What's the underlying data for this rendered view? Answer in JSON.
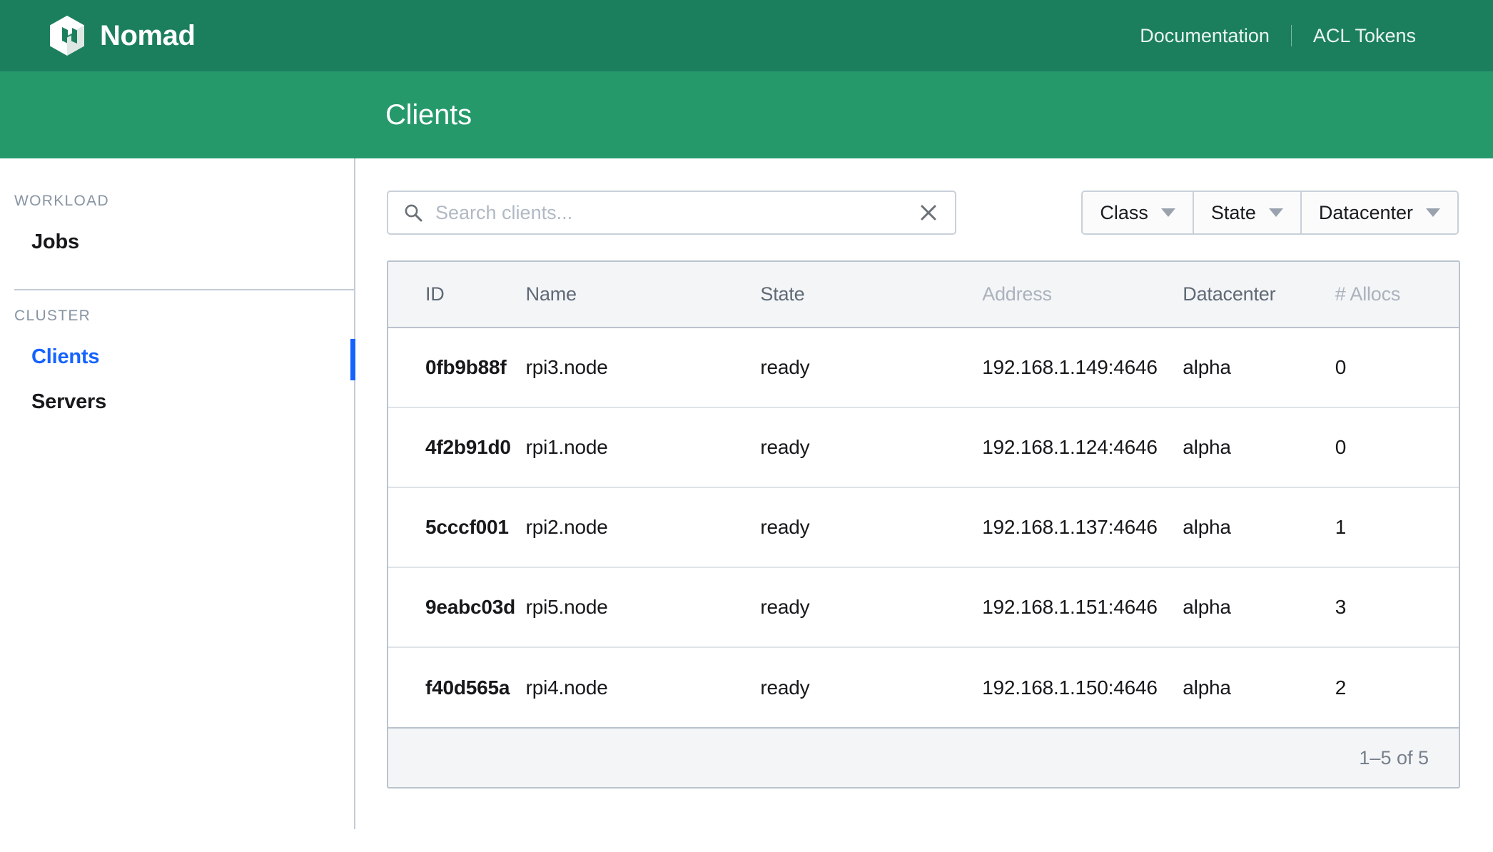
{
  "header": {
    "brand": "Nomad",
    "logo_icon": "nomad-hexagon-logo",
    "links": [
      {
        "label": "Documentation"
      },
      {
        "label": "ACL Tokens"
      }
    ]
  },
  "sub_header": {
    "title": "Clients"
  },
  "sidebar": {
    "sections": [
      {
        "label": "WORKLOAD",
        "items": [
          {
            "label": "Jobs",
            "active": false
          }
        ]
      },
      {
        "label": "CLUSTER",
        "items": [
          {
            "label": "Clients",
            "active": true
          },
          {
            "label": "Servers",
            "active": false
          }
        ]
      }
    ]
  },
  "toolbar": {
    "search": {
      "icon": "search-icon",
      "placeholder": "Search clients...",
      "value": "",
      "clear_icon": "close-icon"
    },
    "filters": [
      {
        "label": "Class",
        "icon": "chevron-down-icon"
      },
      {
        "label": "State",
        "icon": "chevron-down-icon"
      },
      {
        "label": "Datacenter",
        "icon": "chevron-down-icon"
      }
    ]
  },
  "table": {
    "columns": [
      {
        "key": "id",
        "label": "ID",
        "sortable": true
      },
      {
        "key": "name",
        "label": "Name",
        "sortable": true
      },
      {
        "key": "state",
        "label": "State",
        "sortable": true
      },
      {
        "key": "address",
        "label": "Address",
        "sortable": false
      },
      {
        "key": "datacenter",
        "label": "Datacenter",
        "sortable": true
      },
      {
        "key": "allocs",
        "label": "# Allocs",
        "sortable": false
      }
    ],
    "rows": [
      {
        "id": "0fb9b88f",
        "name": "rpi3.node",
        "state": "ready",
        "address": "192.168.1.149:4646",
        "datacenter": "alpha",
        "allocs": "0"
      },
      {
        "id": "4f2b91d0",
        "name": "rpi1.node",
        "state": "ready",
        "address": "192.168.1.124:4646",
        "datacenter": "alpha",
        "allocs": "0"
      },
      {
        "id": "5cccf001",
        "name": "rpi2.node",
        "state": "ready",
        "address": "192.168.1.137:4646",
        "datacenter": "alpha",
        "allocs": "1"
      },
      {
        "id": "9eabc03d",
        "name": "rpi5.node",
        "state": "ready",
        "address": "192.168.1.151:4646",
        "datacenter": "alpha",
        "allocs": "3"
      },
      {
        "id": "f40d565a",
        "name": "rpi4.node",
        "state": "ready",
        "address": "192.168.1.150:4646",
        "datacenter": "alpha",
        "allocs": "2"
      }
    ],
    "footer": {
      "pagination": "1–5 of 5"
    }
  },
  "colors": {
    "header_green": "#1b7f5e",
    "subheader_green": "#26996b",
    "active_blue": "#1563ff",
    "border_gray": "#b9c3ce",
    "muted_text": "#aab2bd"
  }
}
